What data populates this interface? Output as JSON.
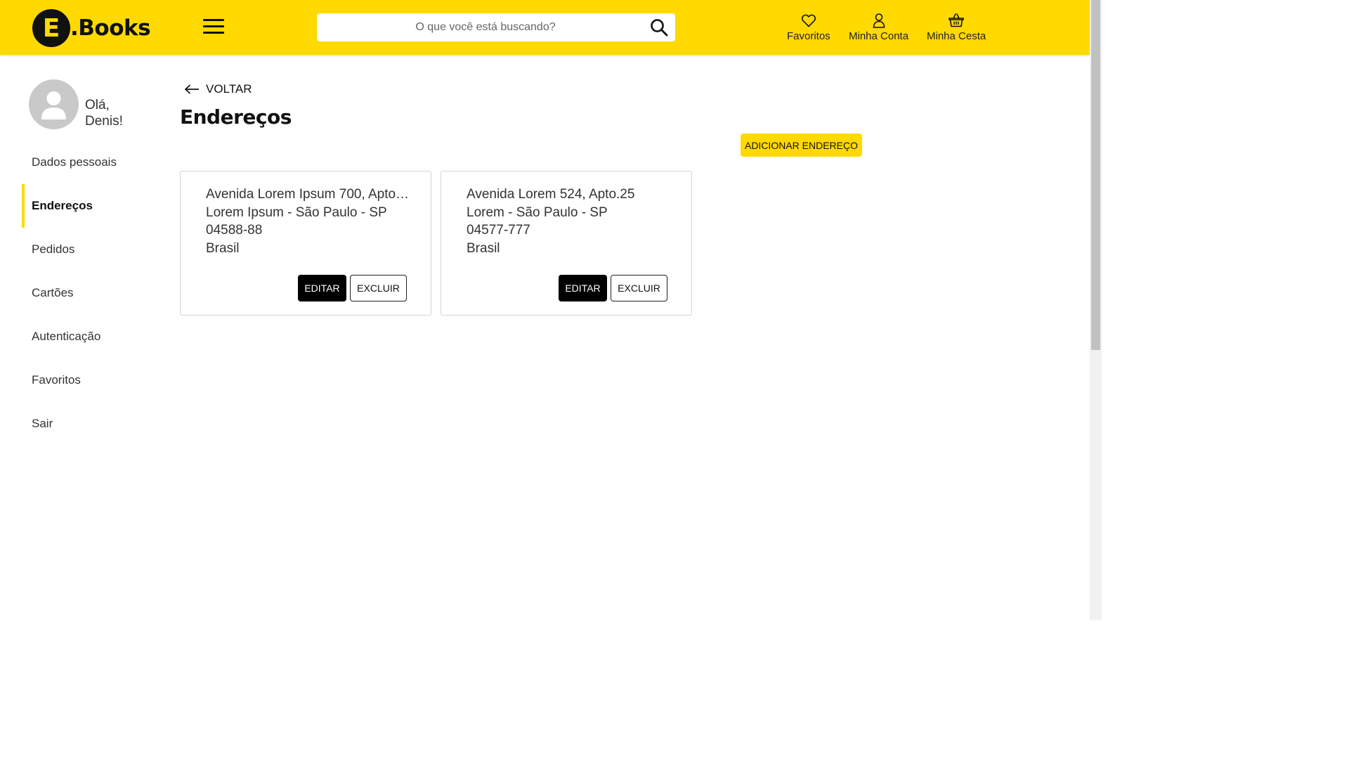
{
  "header": {
    "logo_letter": "E",
    "logo_text": ".Books",
    "search_placeholder": "O que você está buscando?",
    "actions": [
      {
        "label": "Favoritos",
        "icon": "heart-icon"
      },
      {
        "label": "Minha Conta",
        "icon": "user-icon"
      },
      {
        "label": "Minha Cesta",
        "icon": "basket-icon"
      }
    ]
  },
  "sidebar": {
    "greeting": [
      "Olá,",
      "Denis!"
    ],
    "items": [
      {
        "label": "Dados pessoais"
      },
      {
        "label": "Endereços",
        "active": true
      },
      {
        "label": "Pedidos"
      },
      {
        "label": "Cartões"
      },
      {
        "label": "Autenticação"
      },
      {
        "label": "Favoritos"
      },
      {
        "label": "Sair"
      }
    ]
  },
  "main": {
    "back_label": "VOLTAR",
    "title": "Endereços",
    "add_button": "ADICIONAR ENDEREÇO",
    "addresses": [
      {
        "line1": "Avenida Lorem Ipsum 700, Apto....",
        "line2": "Lorem Ipsum - São Paulo - SP",
        "zip": "04588-88",
        "country": "Brasil",
        "edit_label": "EDITAR",
        "delete_label": "EXCLUIR"
      },
      {
        "line1": "Avenida Lorem 524, Apto.25",
        "line2": "Lorem - São Paulo - SP",
        "zip": "04577-777",
        "country": "Brasil",
        "edit_label": "EDITAR",
        "delete_label": "EXCLUIR"
      }
    ]
  },
  "colors": {
    "brand_yellow": "#FFD900",
    "dark": "#111111"
  }
}
